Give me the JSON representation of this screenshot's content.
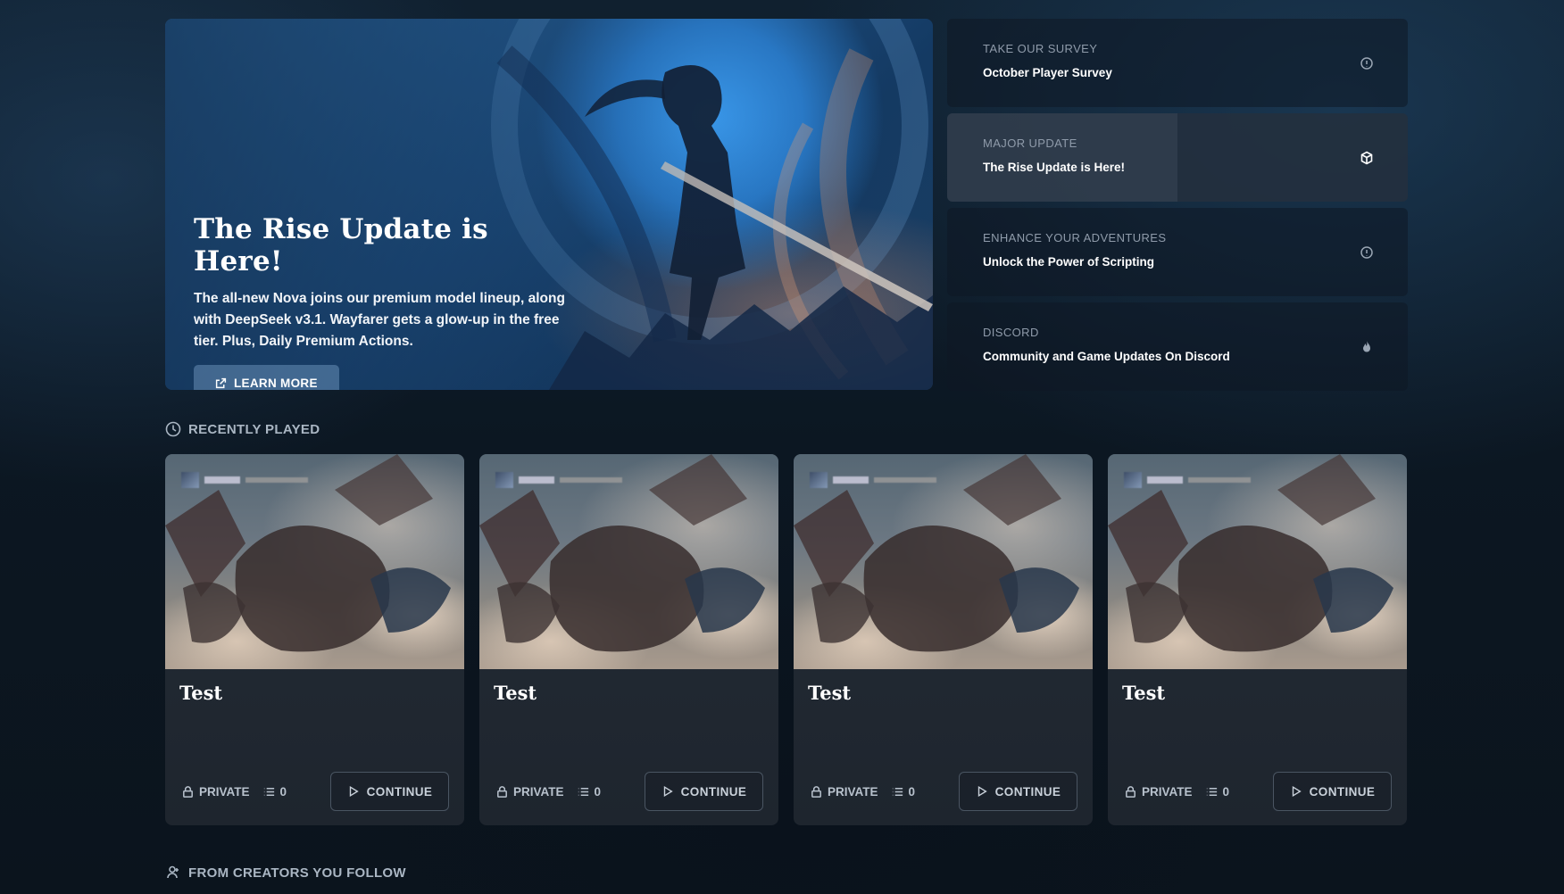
{
  "hero": {
    "title": "The Rise Update is Here!",
    "description": "The all-new Nova joins our premium model lineup, along with DeepSeek v3.1. Wayfarer gets a glow-up in the free tier. Plus, Daily Premium Actions.",
    "button_label": "LEARN MORE"
  },
  "news": [
    {
      "kicker": "TAKE OUR SURVEY",
      "title": "October Player Survey",
      "icon": "info-icon",
      "active": false
    },
    {
      "kicker": "MAJOR UPDATE",
      "title": "The Rise Update is Here!",
      "icon": "cube-icon",
      "active": true
    },
    {
      "kicker": "ENHANCE YOUR ADVENTURES",
      "title": "Unlock the Power of Scripting",
      "icon": "info-icon",
      "active": false
    },
    {
      "kicker": "DISCORD",
      "title": "Community and Game Updates On Discord",
      "icon": "flame-icon",
      "active": false
    }
  ],
  "recently_played": {
    "heading": "RECENTLY PLAYED",
    "cards": [
      {
        "title": "Test",
        "visibility": "PRIVATE",
        "count": "0",
        "action": "CONTINUE"
      },
      {
        "title": "Test",
        "visibility": "PRIVATE",
        "count": "0",
        "action": "CONTINUE"
      },
      {
        "title": "Test",
        "visibility": "PRIVATE",
        "count": "0",
        "action": "CONTINUE"
      },
      {
        "title": "Test",
        "visibility": "PRIVATE",
        "count": "0",
        "action": "CONTINUE"
      }
    ]
  },
  "creators": {
    "heading": "FROM CREATORS YOU FOLLOW"
  }
}
